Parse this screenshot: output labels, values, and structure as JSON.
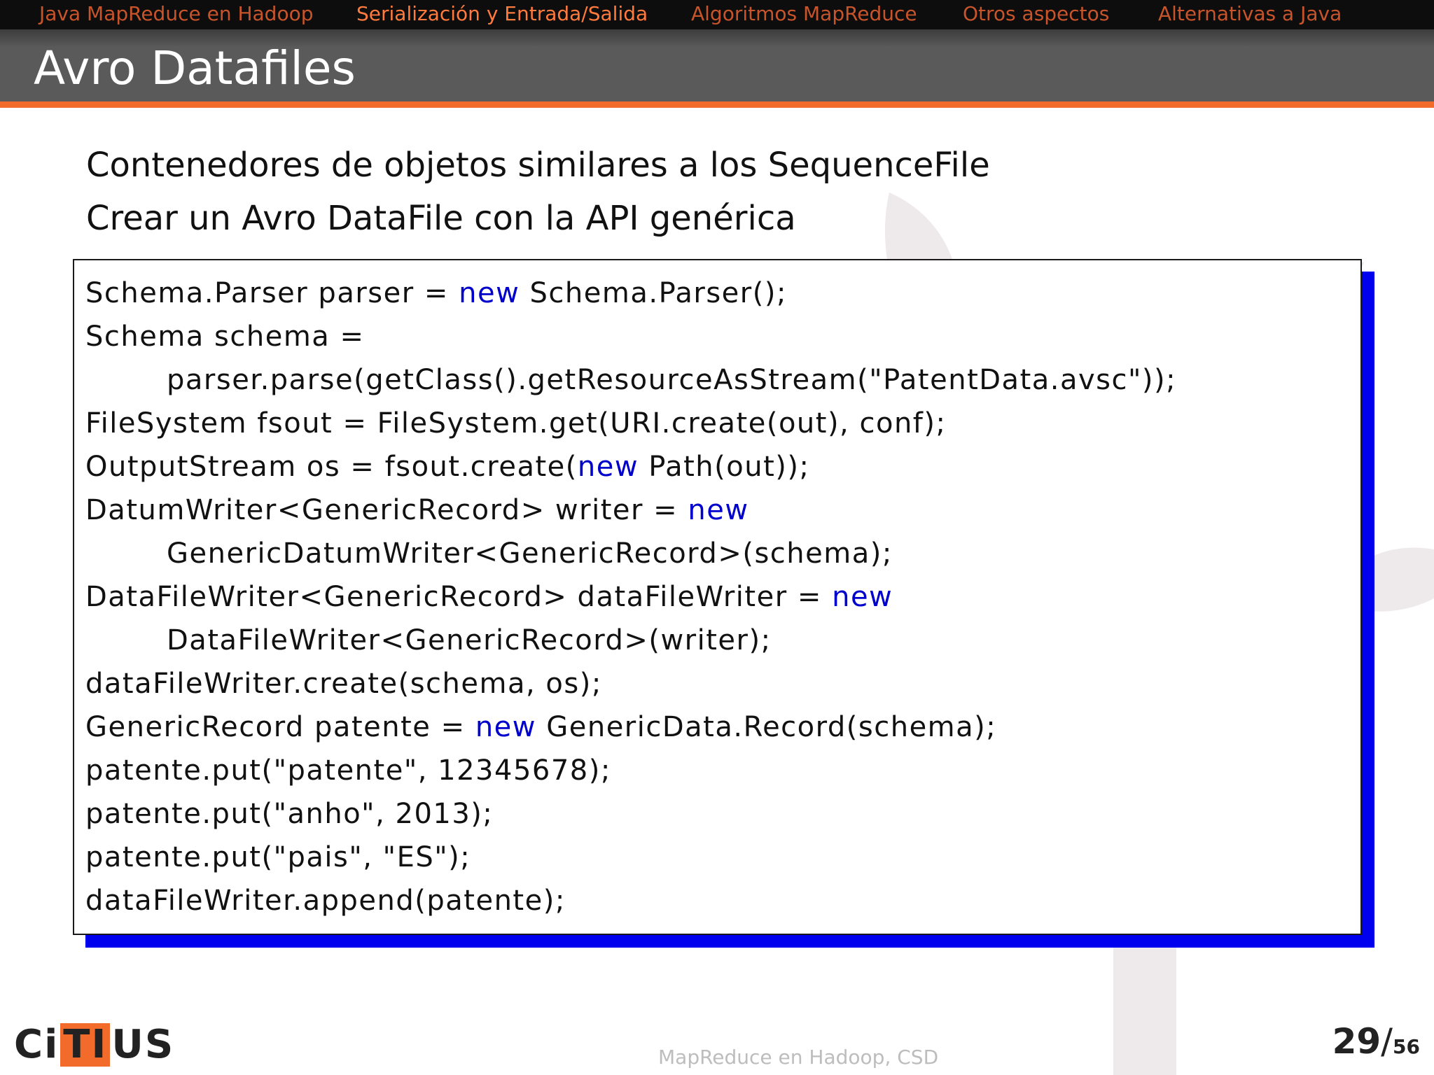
{
  "nav": {
    "items": [
      "Java MapReduce en Hadoop",
      "Serialización y Entrada/Salida",
      "Algoritmos MapReduce",
      "Otros aspectos",
      "Alternativas a Java"
    ],
    "active_index": 1
  },
  "slide": {
    "title": "Avro Datafiles",
    "bullets": [
      "Contenedores de objetos similares a los SequenceFile",
      "Crear un Avro DataFile con la API genérica"
    ]
  },
  "code": {
    "keyword_color": "#0000cc",
    "shadow_color": "#0000ee",
    "lines": [
      {
        "pre": "Schema.Parser parser = ",
        "kw": "new",
        "post": " Schema.Parser();"
      },
      {
        "pre": "Schema schema =",
        "kw": "",
        "post": ""
      },
      {
        "pre": "parser.parse(getClass().getResourceAsStream(\"PatentData.avsc\"));",
        "kw": "",
        "post": ""
      },
      {
        "pre": "FileSystem fsout = FileSystem.get(URI.create(out), conf);",
        "kw": "",
        "post": ""
      },
      {
        "pre": "OutputStream os = fsout.create(",
        "kw": "new",
        "post": " Path(out));"
      },
      {
        "pre": "DatumWriter<GenericRecord> writer = ",
        "kw": "new",
        "post": ""
      },
      {
        "pre": "GenericDatumWriter<GenericRecord>(schema);",
        "kw": "",
        "post": ""
      },
      {
        "pre": "DataFileWriter<GenericRecord> dataFileWriter = ",
        "kw": "new",
        "post": ""
      },
      {
        "pre": "DataFileWriter<GenericRecord>(writer);",
        "kw": "",
        "post": ""
      },
      {
        "pre": "dataFileWriter.create(schema, os);",
        "kw": "",
        "post": ""
      },
      {
        "pre": "GenericRecord patente = ",
        "kw": "new",
        "post": " GenericData.Record(schema);"
      },
      {
        "pre": "patente.put(\"patente\", 12345678);",
        "kw": "",
        "post": ""
      },
      {
        "pre": "patente.put(\"anho\", 2013);",
        "kw": "",
        "post": ""
      },
      {
        "pre": "patente.put(\"pais\", \"ES\");",
        "kw": "",
        "post": ""
      },
      {
        "pre": "dataFileWriter.append(patente);",
        "kw": "",
        "post": ""
      }
    ]
  },
  "footer": {
    "logo_left": "Ci",
    "logo_mid": "TI",
    "logo_right": "US",
    "center_text": "MapReduce en Hadoop, CSD",
    "page_current": "29",
    "page_separator": "/",
    "page_total": "56"
  },
  "colors": {
    "accent_orange": "#f26b2a",
    "nav_active": "#ff7a3d",
    "nav_inactive": "#c7542a"
  },
  "icons": [
    "tree-watermark-icon",
    "citius-logo"
  ]
}
